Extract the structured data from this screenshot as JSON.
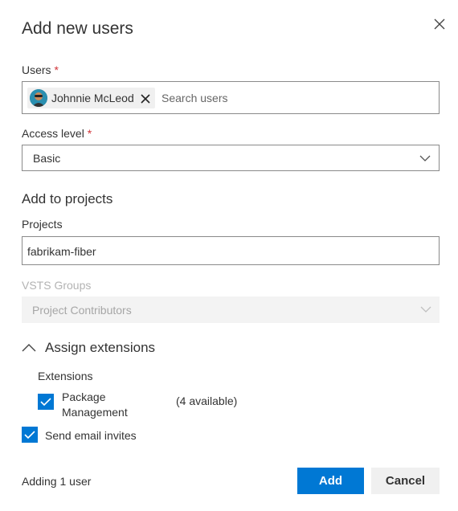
{
  "dialog": {
    "title": "Add new users",
    "close_icon": "close-icon"
  },
  "users": {
    "label": "Users",
    "required_mark": "*",
    "selected_user": "Johnnie McLeod",
    "placeholder": "Search users"
  },
  "access_level": {
    "label": "Access level",
    "required_mark": "*",
    "value": "Basic"
  },
  "projects_section": {
    "title": "Add to projects",
    "projects_label": "Projects",
    "projects_value": "fabrikam-fiber",
    "groups_label": "VSTS Groups",
    "groups_value": "Project Contributors"
  },
  "extensions": {
    "toggle_label": "Assign extensions",
    "label": "Extensions",
    "items": [
      {
        "name_line1": "Package",
        "name_line2": "Management",
        "availability": "(4 available)",
        "checked": true
      }
    ]
  },
  "email": {
    "label": "Send email invites",
    "checked": true
  },
  "footer": {
    "status": "Adding 1 user",
    "add_label": "Add",
    "cancel_label": "Cancel"
  },
  "colors": {
    "accent": "#0078d4",
    "required": "#d13438"
  }
}
